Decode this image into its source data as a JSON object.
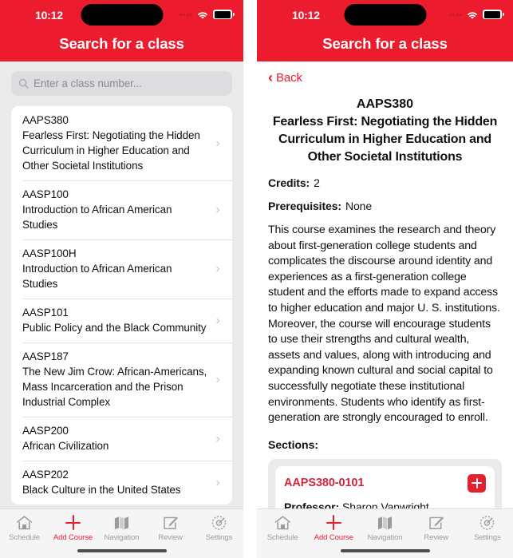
{
  "status": {
    "time": "10:12",
    "signal_icon": "signal-dots-icon",
    "wifi_icon": "wifi-icon",
    "battery_icon": "battery-icon"
  },
  "header": {
    "title": "Search for a class"
  },
  "theme": {
    "brand_red": "#ed1b2e",
    "section_code_red": "#d6243a",
    "page_bg": "#eceaeb",
    "card_bg": "#ffffff"
  },
  "left_panel": {
    "search": {
      "placeholder": "Enter a class number...",
      "value": "",
      "icon": "search-icon"
    },
    "courses": [
      {
        "code": "AAPS380",
        "title": "Fearless First: Negotiating the Hidden Curriculum in Higher Education and Other Societal Institutions"
      },
      {
        "code": "AASP100",
        "title": "Introduction to African American Studies"
      },
      {
        "code": "AASP100H",
        "title": "Introduction to African American Studies"
      },
      {
        "code": "AASP101",
        "title": "Public Policy and the Black Community"
      },
      {
        "code": "AASP187",
        "title": "The New Jim Crow: African-Americans, Mass Incarceration and the Prison Industrial Complex"
      },
      {
        "code": "AASP200",
        "title": "African Civilization"
      },
      {
        "code": "AASP202",
        "title": "Black Culture in the United States"
      }
    ],
    "chevron": "›"
  },
  "right_panel": {
    "back": {
      "label": "Back",
      "icon": "chevron-left-icon"
    },
    "course": {
      "code": "AAPS380",
      "name": "Fearless First: Negotiating the Hidden Curriculum in Higher Education and Other Societal Institutions",
      "credits_label": "Credits:",
      "credits_value": "2",
      "prereq_label": "Prerequisites:",
      "prereq_value": "None",
      "description": "This course examines the research and theory about first-generation college students and complicates the discourse around identity and experiences as a first-generation college student and the efforts made to expand access to higher education and major U. S. institutions. Moreover, the course will encourage students to use their strengths and cultural wealth, assets and values, along with introducing and expanding known cultural and social capital to successfully negotiate these institutional environments. Students who identify as first-generation are strongly encouraged to enroll."
    },
    "sections_label": "Sections:",
    "sections": [
      {
        "code": "AAPS380-0101",
        "professor_label": "Professor:",
        "professor_value": "Sharon Vanwright",
        "add_icon": "plus-icon"
      }
    ]
  },
  "tabbar": {
    "items": [
      {
        "label": "Schedule",
        "icon": "home-icon",
        "active": false
      },
      {
        "label": "Add Course",
        "icon": "plus-icon",
        "active": true
      },
      {
        "label": "Navigation",
        "icon": "map-icon",
        "active": false
      },
      {
        "label": "Review",
        "icon": "compose-icon",
        "active": false
      },
      {
        "label": "Settings",
        "icon": "gear-icon",
        "active": false
      }
    ]
  }
}
